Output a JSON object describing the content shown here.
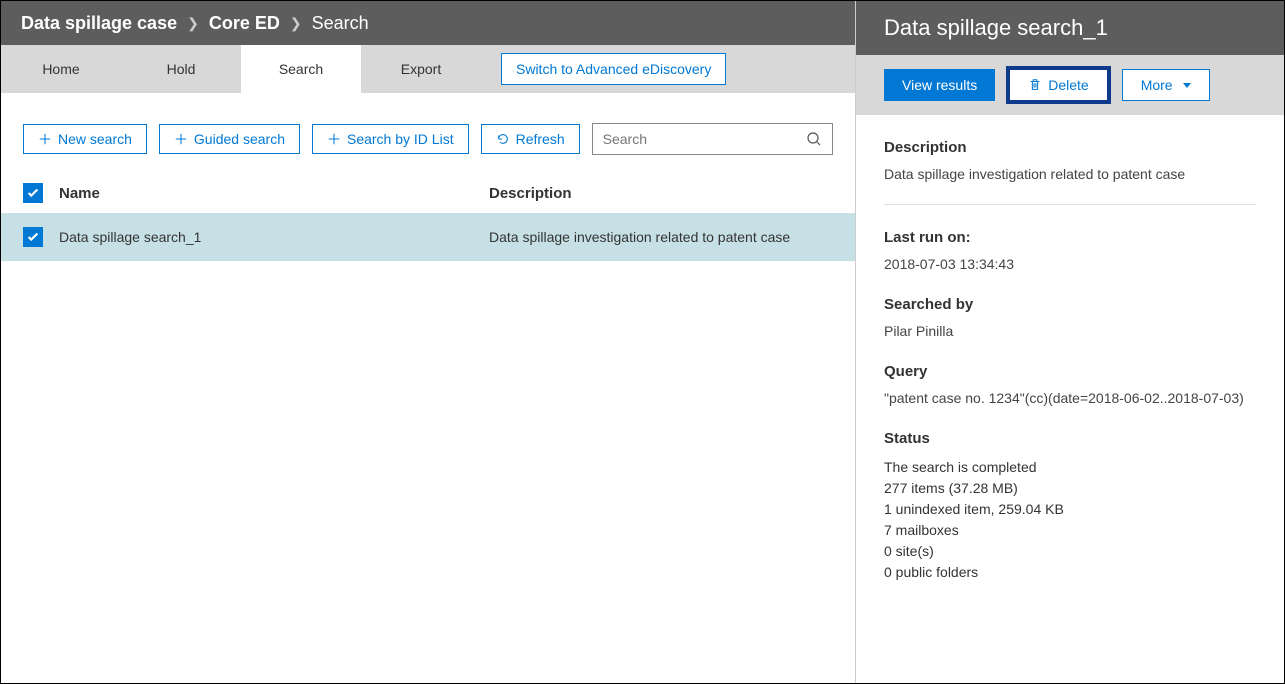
{
  "breadcrumb": {
    "item1": "Data spillage case",
    "item2": "Core ED",
    "item3": "Search"
  },
  "tabs": {
    "home": "Home",
    "hold": "Hold",
    "search": "Search",
    "export": "Export",
    "advanced": "Switch to Advanced eDiscovery"
  },
  "toolbar": {
    "new_search": "New search",
    "guided_search": "Guided search",
    "search_by_id": "Search by ID List",
    "refresh": "Refresh",
    "search_placeholder": "Search"
  },
  "table": {
    "col_name": "Name",
    "col_desc": "Description",
    "rows": [
      {
        "name": "Data spillage search_1",
        "desc": "Data spillage investigation related to patent case"
      }
    ]
  },
  "details": {
    "title": "Data spillage search_1",
    "actions": {
      "view_results": "View results",
      "delete": "Delete",
      "more": "More"
    },
    "description_label": "Description",
    "description_value": "Data spillage investigation related to patent case",
    "last_run_label": "Last run on:",
    "last_run_value": "2018-07-03 13:34:43",
    "searched_by_label": "Searched by",
    "searched_by_value": "Pilar Pinilla",
    "query_label": "Query",
    "query_value": "\"patent case no. 1234\"(cc)(date=2018-06-02..2018-07-03)",
    "status_label": "Status",
    "status_lines": [
      "The search is completed",
      "277 items (37.28 MB)",
      "1 unindexed item, 259.04 KB",
      "7 mailboxes",
      "0 site(s)",
      "0 public folders"
    ]
  }
}
